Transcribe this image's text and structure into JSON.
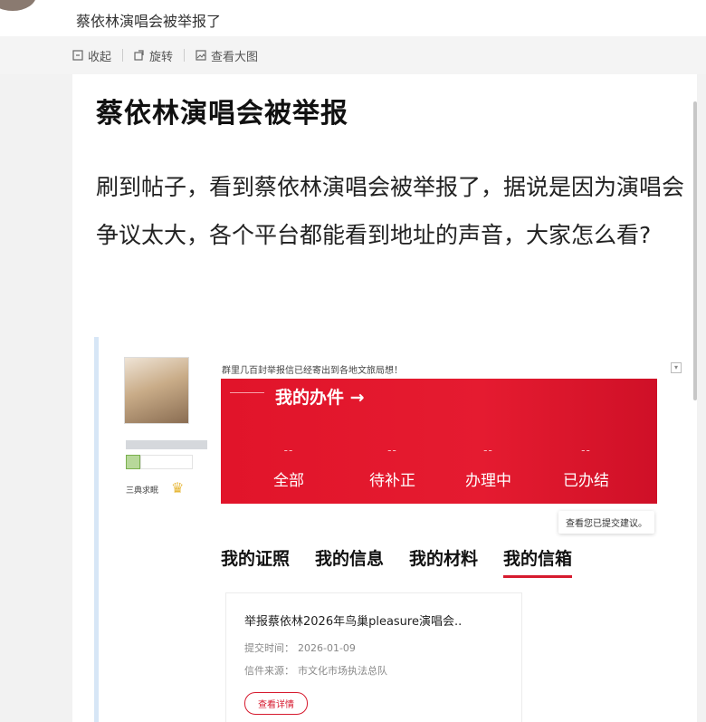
{
  "post": {
    "title": "蔡依林演唱会被举报了"
  },
  "toolbar": {
    "collapse_label": "收起",
    "rotate_label": "旋转",
    "view_large_label": "查看大图"
  },
  "article": {
    "headline": "蔡依林演唱会被举报",
    "body": "刷到帖子，看到蔡依林演唱会被举报了，据说是因为演唱会争议太大，各个平台都能看到地址的声音，大家怎么看?"
  },
  "screenshot": {
    "notice": "群里几百封举报信已经寄出到各地文旅局想！",
    "rank_label": "三典求眠",
    "corner_button": "▾",
    "card": {
      "title": "我的办件 →",
      "stats": [
        {
          "value": "--",
          "label": "全部"
        },
        {
          "value": "--",
          "label": "待补正"
        },
        {
          "value": "--",
          "label": "办理中"
        },
        {
          "value": "--",
          "label": "已办结"
        }
      ]
    },
    "tooltip": "查看您已提交建议。",
    "tabs": [
      "我的证照",
      "我的信息",
      "我的材料",
      "我的信箱"
    ],
    "active_tab_index": 3,
    "letter": {
      "title": "举报蔡依林2026年鸟巢pleasure演唱会..",
      "submit_time_label": "提交时间：",
      "submit_time_value": "2026-01-09",
      "source_label": "信件来源：",
      "source_value": "市文化市场执法总队",
      "detail_button": "查看详情"
    }
  },
  "colors": {
    "accent_red": "#e1142a",
    "page_bg": "#f2f2f2"
  }
}
